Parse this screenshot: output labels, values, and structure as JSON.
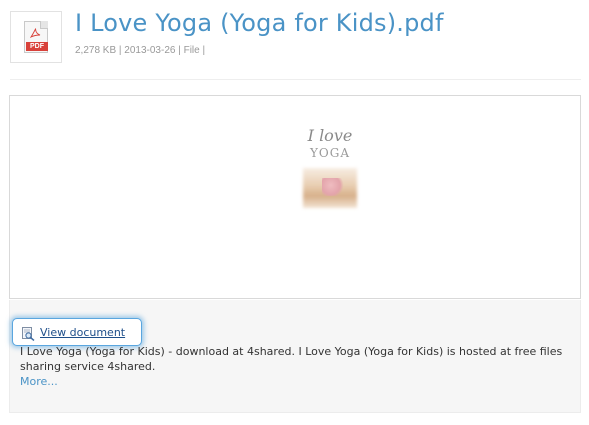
{
  "file": {
    "title": "I Love Yoga (Yoga for Kids).pdf",
    "meta": "2,278 KB | 2013-03-26 | File |",
    "type_badge": "PDF"
  },
  "preview": {
    "cover_title": "I love",
    "cover_subtitle": "YOGA"
  },
  "actions": {
    "view_document_label": "View document",
    "more_label": "More..."
  },
  "description": "I Love Yoga (Yoga for Kids) - download at 4shared. I Love Yoga (Yoga for Kids) is hosted at free files sharing service 4shared.",
  "icons": {
    "file_type": "pdf-file-icon",
    "view": "document-magnifier-icon"
  },
  "colors": {
    "title": "#4a93c6",
    "link": "#1f4f8a",
    "pdf_red": "#d8413a",
    "focus_glow": "#5aa6df"
  }
}
